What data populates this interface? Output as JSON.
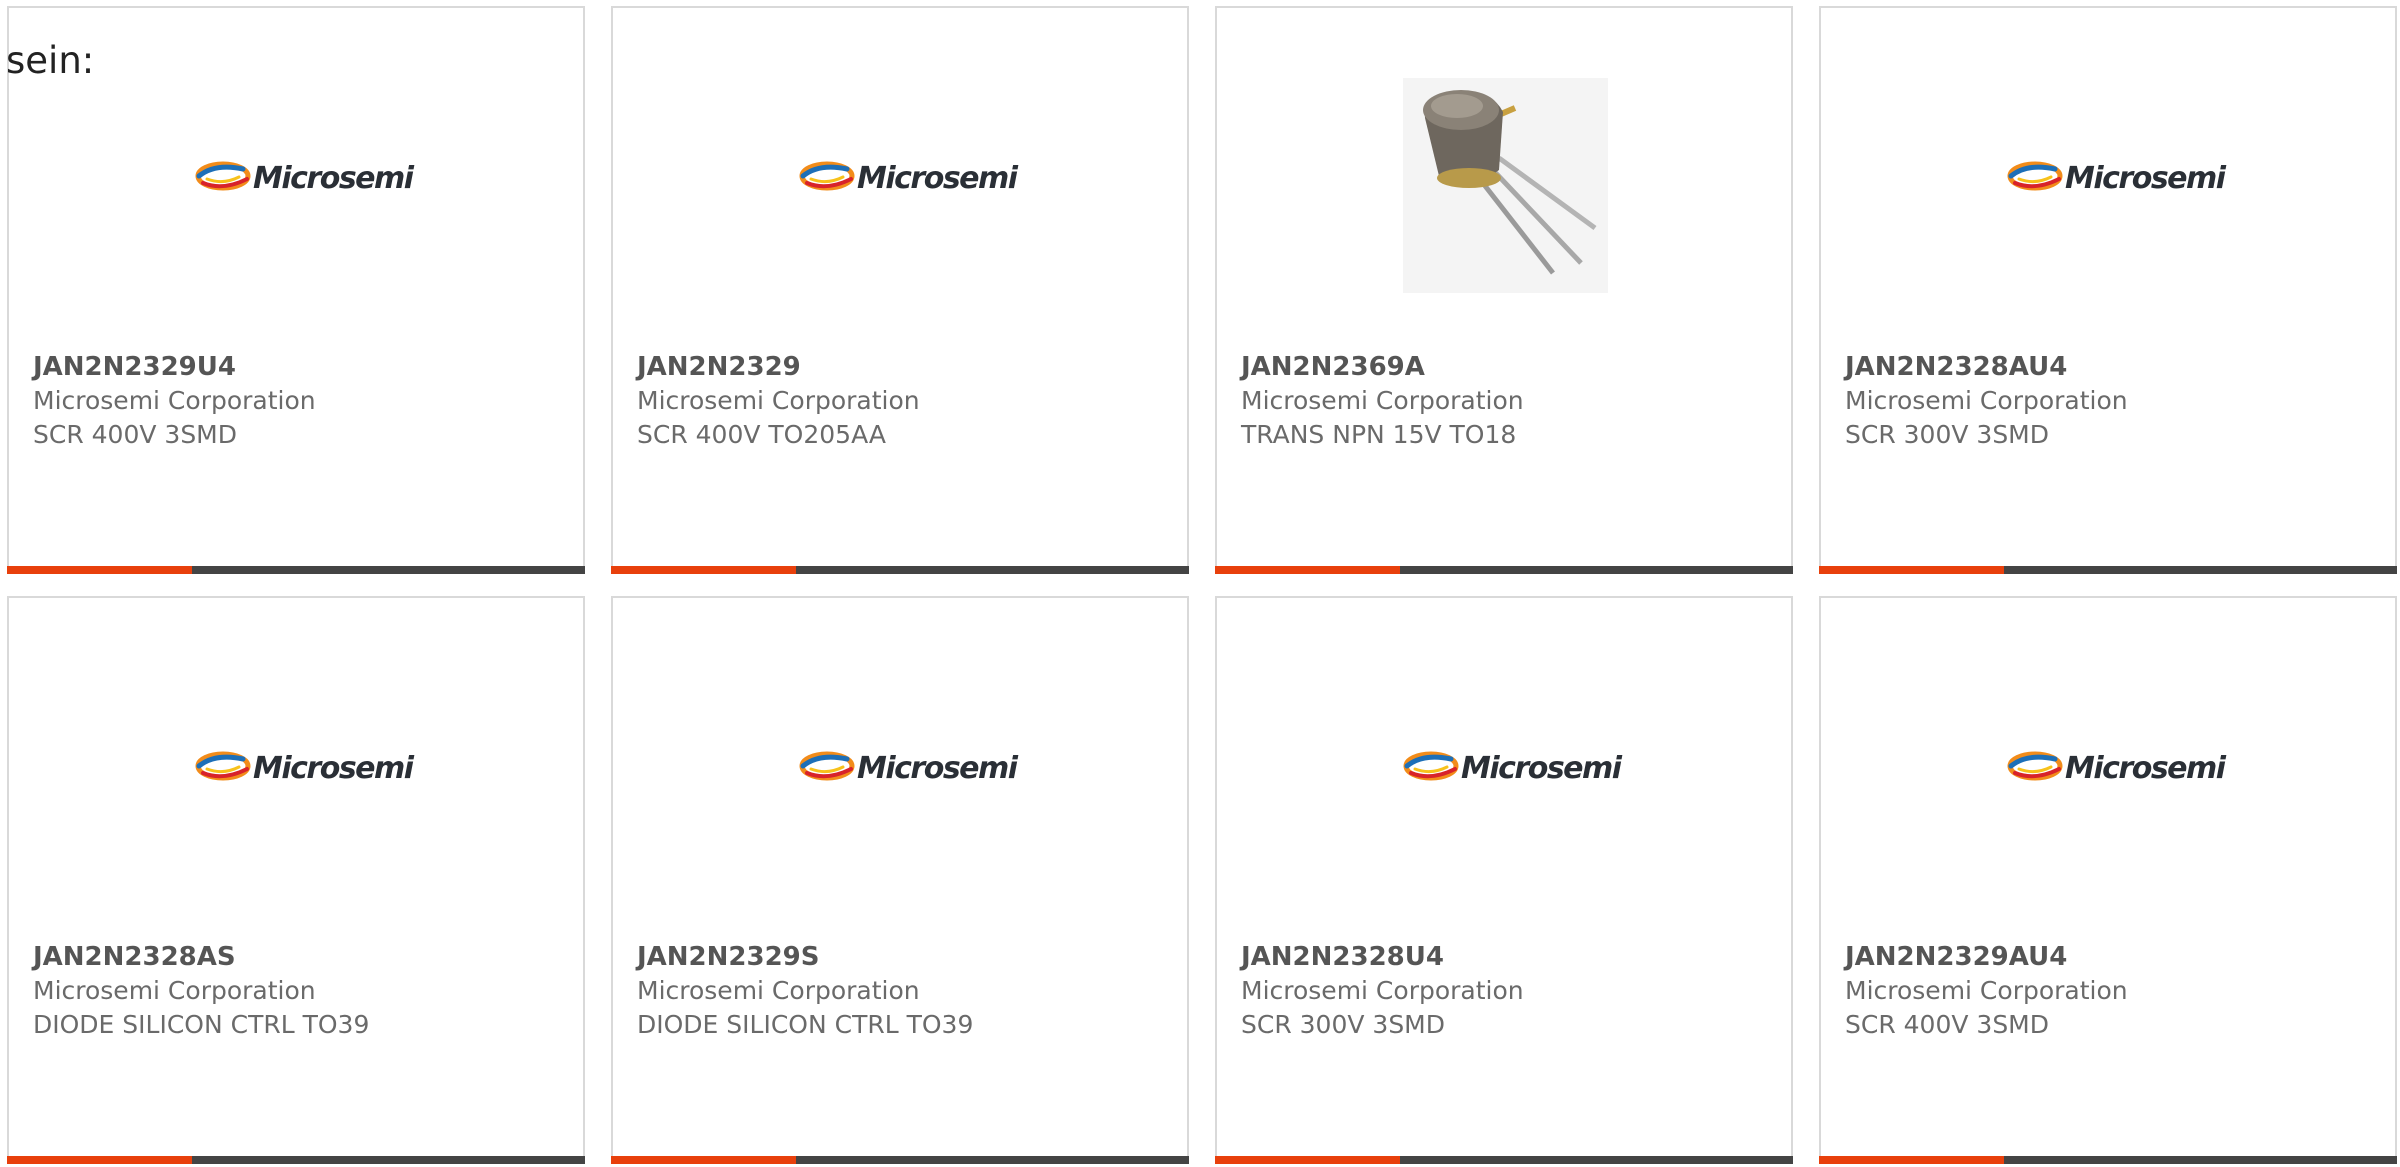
{
  "intro_text": "sein:",
  "colors": {
    "accent": "#e8400c",
    "bar_dark": "#444444",
    "card_border": "#d9d9d9"
  },
  "accent_fraction": 0.32,
  "products": [
    {
      "part_number": "JAN2N2329U4",
      "manufacturer": "Microsemi Corporation",
      "description": "SCR 400V 3SMD",
      "image": "microsemi-logo",
      "logo_text": "Microsemi"
    },
    {
      "part_number": "JAN2N2329",
      "manufacturer": "Microsemi Corporation",
      "description": "SCR 400V TO205AA",
      "image": "microsemi-logo",
      "logo_text": "Microsemi"
    },
    {
      "part_number": "JAN2N2369A",
      "manufacturer": "Microsemi Corporation",
      "description": "TRANS NPN 15V TO18",
      "image": "transistor-photo",
      "logo_text": ""
    },
    {
      "part_number": "JAN2N2328AU4",
      "manufacturer": "Microsemi Corporation",
      "description": "SCR 300V 3SMD",
      "image": "microsemi-logo",
      "logo_text": "Microsemi"
    },
    {
      "part_number": "JAN2N2328AS",
      "manufacturer": "Microsemi Corporation",
      "description": "DIODE SILICON CTRL TO39",
      "image": "microsemi-logo",
      "logo_text": "Microsemi"
    },
    {
      "part_number": "JAN2N2329S",
      "manufacturer": "Microsemi Corporation",
      "description": "DIODE SILICON CTRL TO39",
      "image": "microsemi-logo",
      "logo_text": "Microsemi"
    },
    {
      "part_number": "JAN2N2328U4",
      "manufacturer": "Microsemi Corporation",
      "description": "SCR 300V 3SMD",
      "image": "microsemi-logo",
      "logo_text": "Microsemi"
    },
    {
      "part_number": "JAN2N2329AU4",
      "manufacturer": "Microsemi Corporation",
      "description": "SCR 400V 3SMD",
      "image": "microsemi-logo",
      "logo_text": "Microsemi"
    }
  ]
}
